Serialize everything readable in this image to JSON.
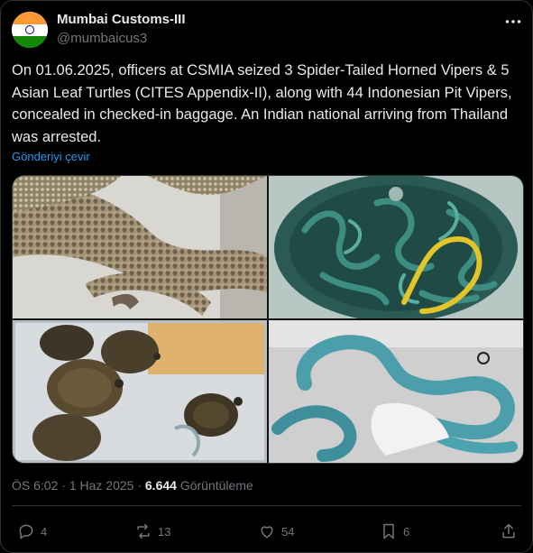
{
  "author": {
    "name": "Mumbai Customs-III",
    "handle": "@mumbaicus3",
    "avatar_icon": "india-flag-icon"
  },
  "post": {
    "text": "On 01.06.2025, officers at CSMIA seized 3 Spider-Tailed Horned Vipers & 5 Asian Leaf Turtles (CITES Appendix-II), along with 44 Indonesian Pit Vipers, concealed in checked-in baggage. An Indian national arriving from Thailand was arrested.",
    "translate_label": "Gönderiyi çevir"
  },
  "media": [
    {
      "icon": "spider-tailed-viper-photo"
    },
    {
      "icon": "pit-vipers-in-container-photo"
    },
    {
      "icon": "asian-leaf-turtles-photo"
    },
    {
      "icon": "blue-pit-viper-photo"
    }
  ],
  "meta": {
    "time": "ÖS 6:02",
    "separator": "·",
    "date": "1 Haz 2025",
    "views_count": "6.644",
    "views_label": "Görüntüleme"
  },
  "actions": {
    "replies": "4",
    "reposts": "13",
    "likes": "54",
    "bookmarks": "6"
  },
  "colors": {
    "background": "#000000",
    "text": "#e7e9ea",
    "muted": "#71767b",
    "link": "#1d9bf0",
    "border": "#2f3336"
  }
}
